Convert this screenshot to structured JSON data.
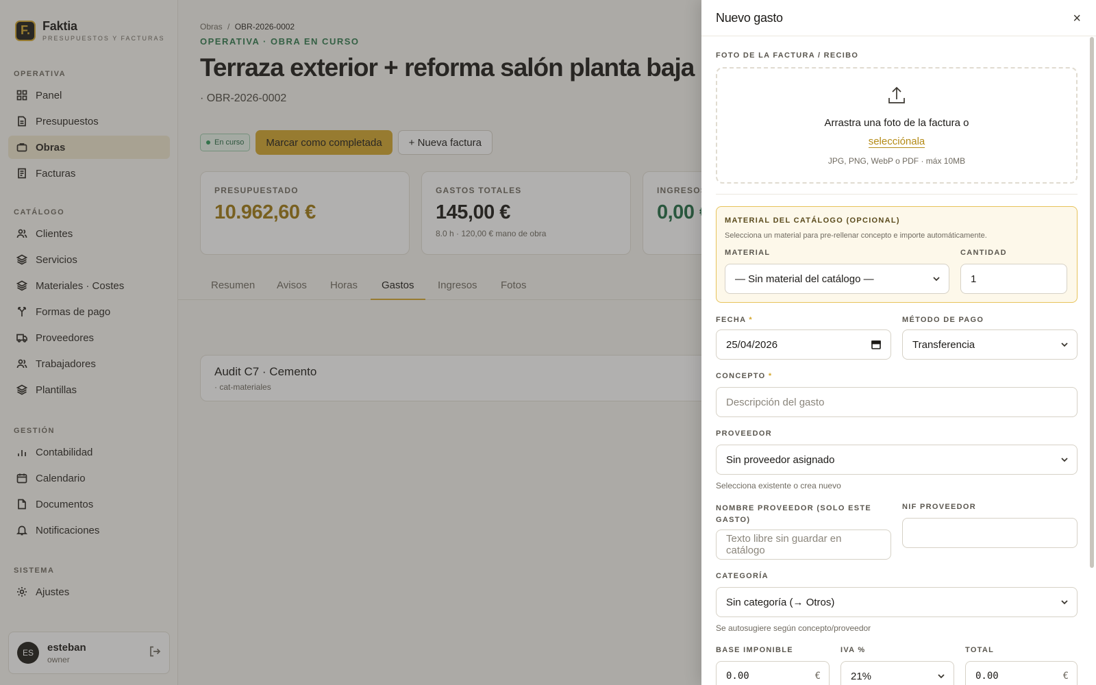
{
  "brand": {
    "logo_letter": "F.",
    "name": "Faktia",
    "subtitle": "PRESUPUESTOS Y FACTURAS"
  },
  "sidebar": {
    "sections": [
      {
        "heading": "OPERATIVA",
        "items": [
          {
            "label": "Panel",
            "icon": "grid-icon"
          },
          {
            "label": "Presupuestos",
            "icon": "document-icon"
          },
          {
            "label": "Obras",
            "icon": "briefcase-icon",
            "active": true
          },
          {
            "label": "Facturas",
            "icon": "invoice-icon"
          }
        ]
      },
      {
        "heading": "CATÁLOGO",
        "items": [
          {
            "label": "Clientes",
            "icon": "users-icon"
          },
          {
            "label": "Servicios",
            "icon": "layers-icon"
          },
          {
            "label": "Materiales · Costes",
            "icon": "layers-icon"
          },
          {
            "label": "Formas de pago",
            "icon": "split-icon"
          },
          {
            "label": "Proveedores",
            "icon": "truck-icon"
          },
          {
            "label": "Trabajadores",
            "icon": "users-icon"
          },
          {
            "label": "Plantillas",
            "icon": "layers-icon"
          }
        ]
      },
      {
        "heading": "GESTIÓN",
        "items": [
          {
            "label": "Contabilidad",
            "icon": "bar-chart-icon"
          },
          {
            "label": "Calendario",
            "icon": "calendar-icon"
          },
          {
            "label": "Documentos",
            "icon": "file-icon"
          },
          {
            "label": "Notificaciones",
            "icon": "bell-icon"
          }
        ]
      },
      {
        "heading": "SISTEMA",
        "items": [
          {
            "label": "Ajustes",
            "icon": "gear-icon"
          }
        ]
      }
    ]
  },
  "user": {
    "initials": "ES",
    "name": "esteban",
    "role": "owner"
  },
  "main": {
    "breadcrumb": {
      "parent": "Obras",
      "separator": "/",
      "current": "OBR-2026-0002"
    },
    "eyebrow": "OPERATIVA · OBRA EN CURSO",
    "title": "Terraza exterior + reforma salón planta baja",
    "subtitle": "· OBR-2026-0002",
    "status": "En curso",
    "complete_button": "Marcar como completada",
    "new_invoice_button": "+ Nueva factura",
    "stats": [
      {
        "label": "PRESUPUESTADO",
        "value": "10.962,60 €",
        "note": "",
        "color": "#a07a12"
      },
      {
        "label": "GASTOS TOTALES",
        "value": "145,00 €",
        "note": "8.0 h · 120,00 € mano de obra",
        "color": "#1c1a17"
      },
      {
        "label": "INGRESOS",
        "value": "0,00 €",
        "note": "",
        "color": "#1f6b43"
      }
    ],
    "tabs": [
      "Resumen",
      "Avisos",
      "Horas",
      "Gastos",
      "Ingresos",
      "Fotos"
    ],
    "active_tab": "Gastos",
    "expense": {
      "title": "Audit C7 · Cemento",
      "category": "· cat-materiales"
    }
  },
  "drawer": {
    "title": "Nuevo gasto",
    "close": "×",
    "photo_label": "FOTO DE LA FACTURA / RECIBO",
    "dropzone_text": "Arrastra una foto de la factura o",
    "dropzone_link": "selecciónala",
    "dropzone_note": "JPG, PNG, WebP o PDF · máx 10MB",
    "catalog": {
      "heading": "MATERIAL DEL CATÁLOGO (OPCIONAL)",
      "help": "Selecciona un material para pre-rellenar concepto e importe automáticamente.",
      "material_label": "MATERIAL",
      "material_value": "— Sin material del catálogo —",
      "quantity_label": "CANTIDAD",
      "quantity_value": "1"
    },
    "date_label": "FECHA",
    "date_value": "25/04/2026",
    "payment_label": "MÉTODO DE PAGO",
    "payment_value": "Transferencia",
    "concept_label": "CONCEPTO",
    "concept_placeholder": "Descripción del gasto",
    "supplier_label": "PROVEEDOR",
    "supplier_value": "Sin proveedor asignado",
    "supplier_hint": "Selecciona existente o crea nuevo",
    "supplier_name_label": "NOMBRE PROVEEDOR (SOLO ESTE GASTO)",
    "supplier_name_placeholder": "Texto libre sin guardar en catálogo",
    "supplier_nif_label": "NIF PROVEEDOR",
    "supplier_nif_value": "",
    "category_label": "CATEGORÍA",
    "category_value": "Sin categoría (→ Otros)",
    "category_hint": "Se autosugiere según concepto/proveedor",
    "base_label": "BASE IMPONIBLE",
    "base_value": "0.00",
    "vat_label": "IVA %",
    "vat_value": "21%",
    "total_label": "TOTAL",
    "total_value": "0.00",
    "currency": "€",
    "required_mark": "*"
  }
}
